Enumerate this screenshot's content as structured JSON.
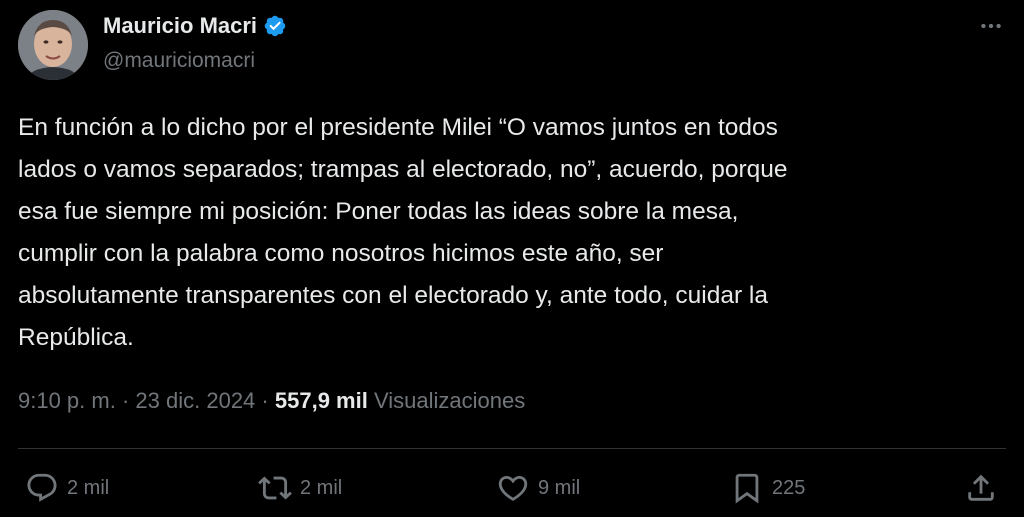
{
  "author": {
    "display_name": "Mauricio Macri",
    "handle": "@mauriciomacri",
    "verified": true,
    "verified_color": "#1d9bf0"
  },
  "tweet": {
    "text": "En función a lo dicho por el presidente Milei “O vamos juntos en todos\nlados o vamos separados; trampas al electorado, no”, acuerdo, porque\nesa fue siempre mi posición: Poner todas las ideas sobre la mesa,\ncumplir con la palabra como nosotros hicimos este año, ser\nabsolutamente transparentes con el electorado y, ante todo, cuidar la\nRepública."
  },
  "meta": {
    "time": "9:10 p. m.",
    "separator": "·",
    "date": "23 dic. 2024",
    "views_count": "557,9 mil",
    "views_label": "Visualizaciones"
  },
  "actions": {
    "replies": {
      "icon": "reply-icon",
      "count": "2 mil"
    },
    "reposts": {
      "icon": "repost-icon",
      "count": "2 mil"
    },
    "likes": {
      "icon": "heart-icon",
      "count": "9 mil"
    },
    "bookmarks": {
      "icon": "bookmark-icon",
      "count": "225"
    },
    "share": {
      "icon": "share-icon"
    }
  },
  "colors": {
    "background": "#000000",
    "text_primary": "#e7e9ea",
    "text_secondary": "#71767b",
    "divider": "#2f3336"
  }
}
